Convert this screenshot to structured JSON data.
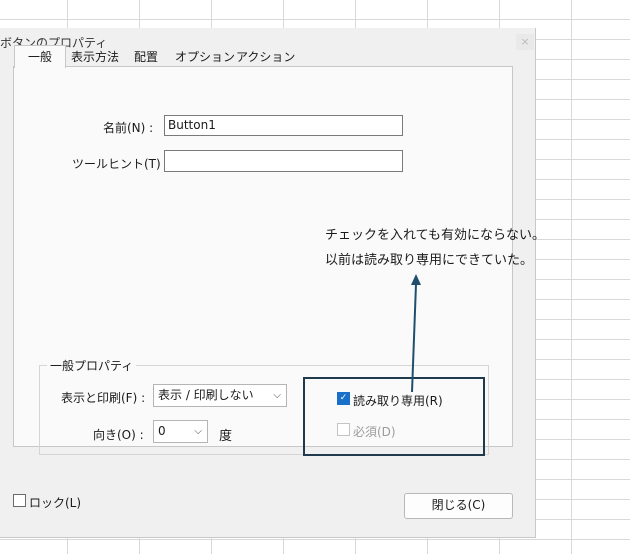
{
  "dialog": {
    "title": "ボタンのプロパティ",
    "close_icon": "×"
  },
  "tabs": [
    {
      "label": "一般",
      "active": true
    },
    {
      "label": "表示方法",
      "active": false
    },
    {
      "label": "配置",
      "active": false
    },
    {
      "label": "オプション",
      "active": false
    },
    {
      "label": "アクション",
      "active": false
    }
  ],
  "general": {
    "name_label": "名前(N) :",
    "name_value": "Button1",
    "tooltip_label": "ツールヒント(T) :",
    "tooltip_value": ""
  },
  "common_props": {
    "title": "一般プロパティ",
    "visibility_label": "表示と印刷(F) :",
    "visibility_value": "表示 / 印刷しない",
    "orientation_label": "向き(O) :",
    "orientation_value": "0",
    "orientation_unit": "度",
    "readonly_label": "読み取り専用(R)",
    "readonly_checked": true,
    "required_label": "必須(D)",
    "required_checked": false
  },
  "footer": {
    "lock_label": "ロック(L)",
    "lock_checked": false,
    "close_label": "閉じる(C)"
  },
  "annotation": {
    "line1": "チェックを入れても有効にならない。",
    "line2": "以前は読み取り専用にできていた。",
    "color": "#1f3a4d"
  },
  "icons": {
    "check": "✓",
    "chevron": "⌵"
  }
}
